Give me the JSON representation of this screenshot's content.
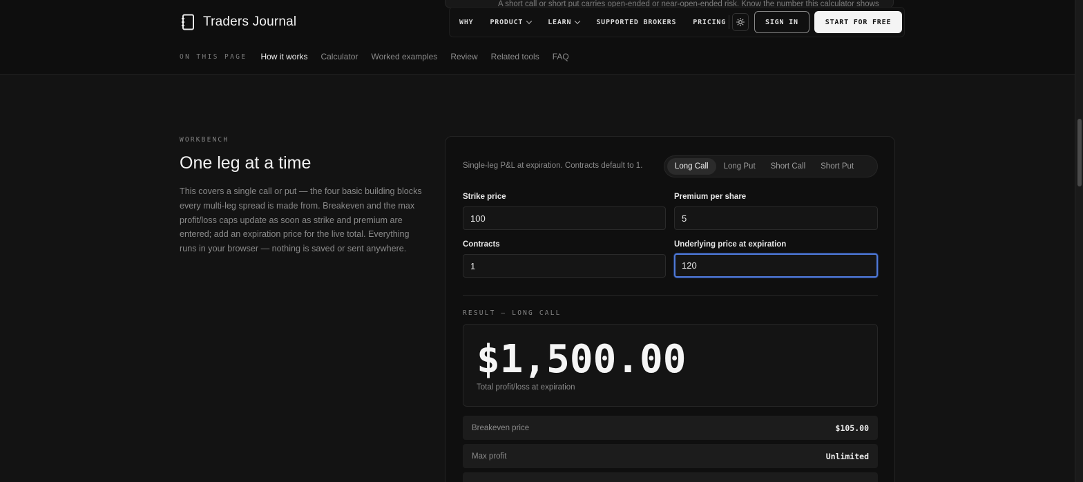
{
  "peek": {
    "text": "A short call or short put carries open-ended or near-open-ended risk. Know the number this calculator shows"
  },
  "brand": {
    "name": "Traders Journal",
    "icon": "notebook-icon"
  },
  "nav": {
    "links": [
      {
        "label": "WHY"
      },
      {
        "label": "PRODUCT"
      },
      {
        "label": "LEARN"
      },
      {
        "label": "SUPPORTED BROKERS"
      },
      {
        "label": "PRICING"
      }
    ],
    "theme_icon": "sun-icon",
    "sign_in": "SIGN IN",
    "start": "START FOR FREE"
  },
  "on_this_page": {
    "label": "ON THIS PAGE",
    "links": [
      "How it works",
      "Calculator",
      "Worked examples",
      "Review",
      "Related tools",
      "FAQ"
    ],
    "active": "How it works"
  },
  "section": {
    "eyebrow": "WORKBENCH",
    "title": "One leg at a time",
    "lead": "This covers a single call or put — the four basic building blocks every multi-leg spread is made from. Breakeven and the max profit/loss caps update as soon as strike and premium are entered; add an expiration price for the live total. Everything runs in your browser — nothing is saved or sent anywhere."
  },
  "calculator": {
    "description": "Single-leg P&L at expiration. Contracts default to 1.",
    "legs": [
      "Long Call",
      "Long Put",
      "Short Call",
      "Short Put"
    ],
    "selected_leg": "Long Call",
    "fields": {
      "strike": {
        "label": "Strike price",
        "value": "100"
      },
      "premium": {
        "label": "Premium per share",
        "value": "5"
      },
      "contracts": {
        "label": "Contracts",
        "value": "1"
      },
      "underlying": {
        "label": "Underlying price at expiration",
        "value": "120"
      }
    },
    "result_label": "RESULT — LONG CALL",
    "result_value": "$1,500.00",
    "result_caption": "Total profit/loss at expiration",
    "stats": [
      {
        "label": "Breakeven price",
        "value": "$105.00"
      },
      {
        "label": "Max profit",
        "value": "Unlimited"
      }
    ]
  },
  "colors": {
    "accent_focus": "#4f79d8",
    "background": "#131313",
    "card": "#0f0f0f"
  }
}
